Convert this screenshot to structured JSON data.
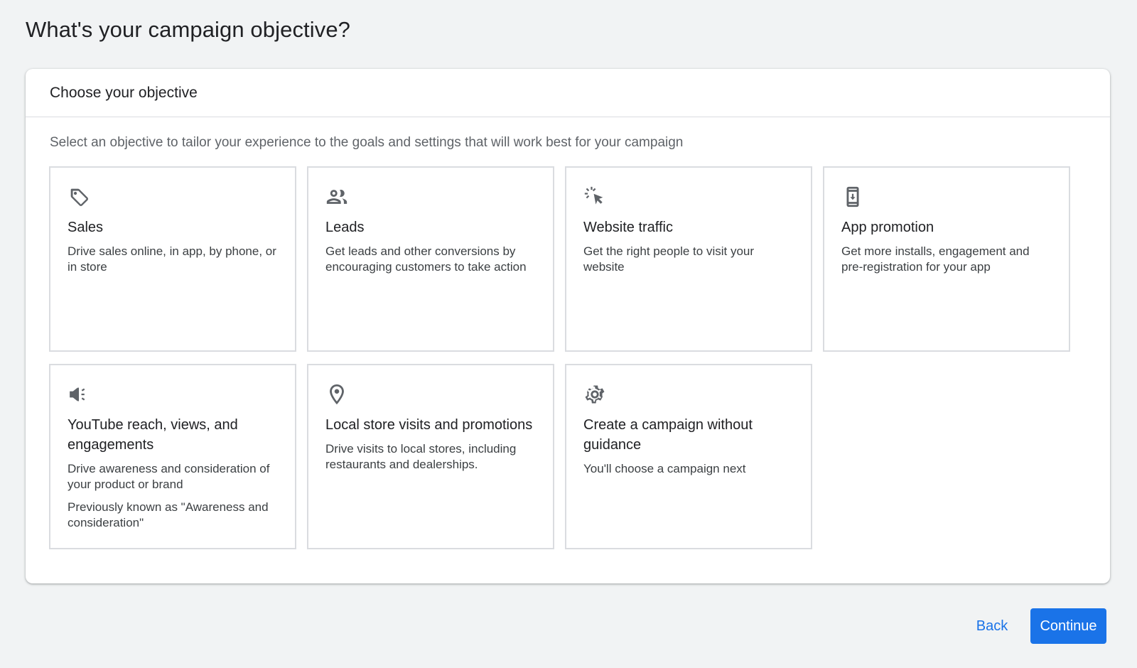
{
  "page": {
    "title": "What's your campaign objective?"
  },
  "card": {
    "title": "Choose your objective",
    "intro": "Select an objective to tailor your experience to the goals and settings that will work best for your campaign"
  },
  "objectives": [
    {
      "icon": "tag-icon",
      "title": "Sales",
      "description": "Drive sales online, in app, by phone, or in store",
      "note": ""
    },
    {
      "icon": "people-icon",
      "title": "Leads",
      "description": "Get leads and other conversions by encouraging customers to take action",
      "note": ""
    },
    {
      "icon": "cursor-click-icon",
      "title": "Website traffic",
      "description": "Get the right people to visit your website",
      "note": ""
    },
    {
      "icon": "phone-download-icon",
      "title": "App promotion",
      "description": "Get more installs, engagement and pre-registration for your app",
      "note": ""
    },
    {
      "icon": "megaphone-icon",
      "title": "YouTube reach, views, and engagements",
      "description": "Drive awareness and consideration of your product or brand",
      "note": "Previously known as \"Awareness and consideration\""
    },
    {
      "icon": "location-pin-icon",
      "title": "Local store visits and promotions",
      "description": "Drive visits to local stores, including restaurants and dealerships.",
      "note": ""
    },
    {
      "icon": "gear-icon",
      "title": "Create a campaign without guidance",
      "description": "You'll choose a campaign next",
      "note": ""
    }
  ],
  "footer": {
    "back_label": "Back",
    "continue_label": "Continue"
  },
  "colors": {
    "background": "#f1f3f4",
    "accent": "#1a73e8",
    "tile_border": "#dadce0",
    "icon": "#5f6368"
  }
}
